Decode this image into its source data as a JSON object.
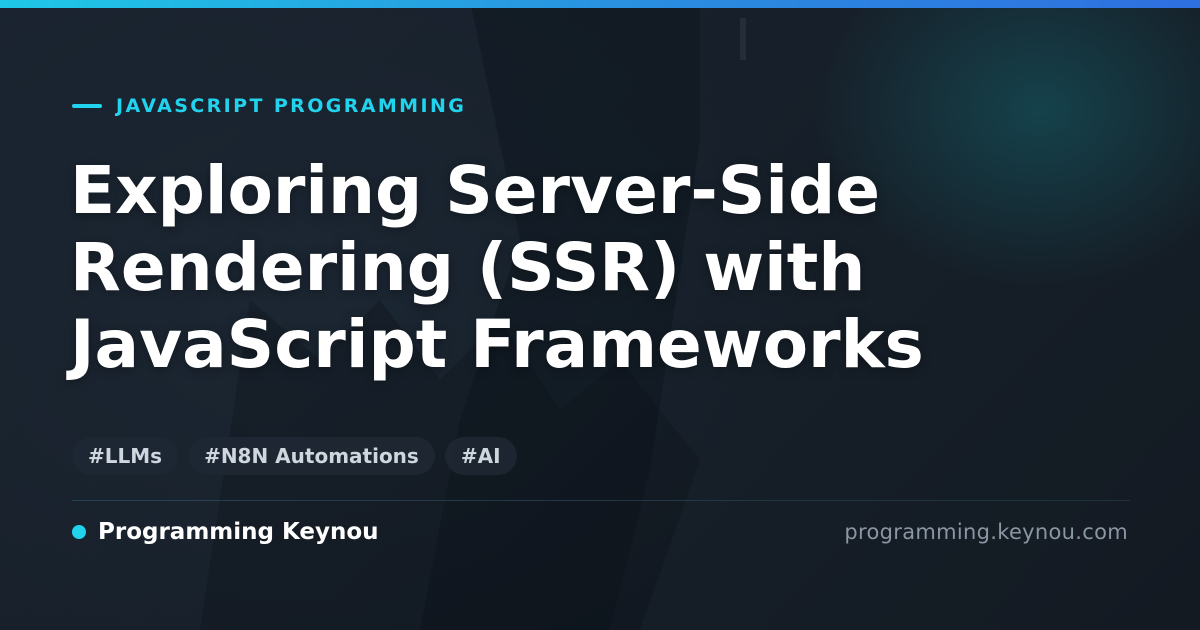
{
  "header": {
    "accent_color": "#22d3ee",
    "bar_gradient": [
      "#1fc8e6",
      "#2f6fe0"
    ]
  },
  "article": {
    "category": "JAVASCRIPT PROGRAMMING",
    "title_lines": [
      "Exploring Server-Side",
      "Rendering (SSR) with",
      "JavaScript Frameworks"
    ],
    "tags": [
      "#LLMs",
      "#N8N Automations",
      "#AI"
    ]
  },
  "footer": {
    "brand_name": "Programming Keynou",
    "site_url": "programming.keynou.com"
  }
}
